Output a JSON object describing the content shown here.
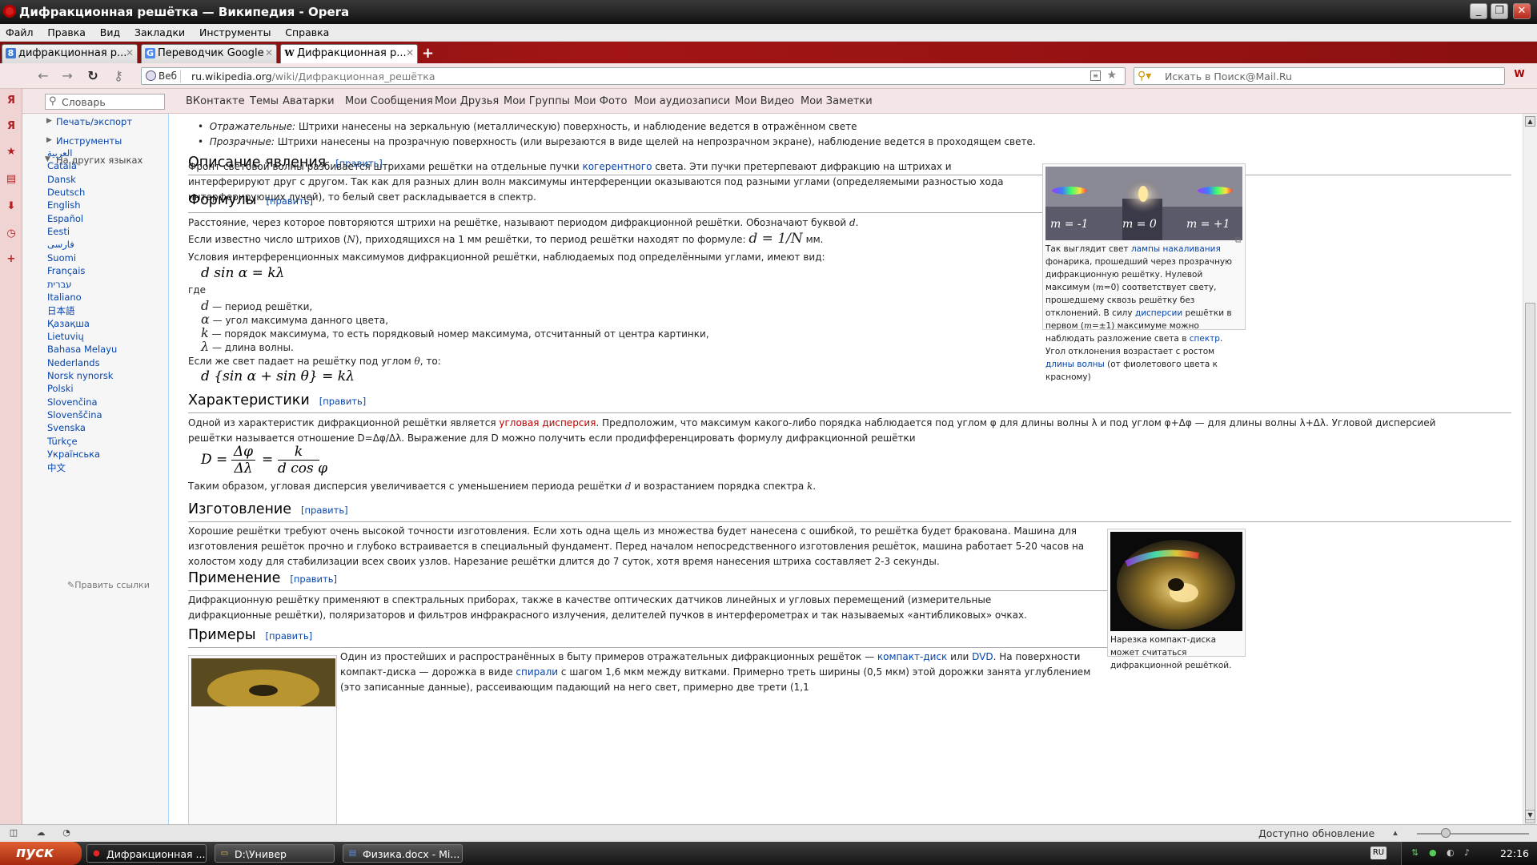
{
  "window": {
    "title": "Дифракционная решётка — Википедия - Opera"
  },
  "menu": [
    "Файл",
    "Правка",
    "Вид",
    "Закладки",
    "Инструменты",
    "Справка"
  ],
  "tabs": [
    {
      "label": "дифракционная р...",
      "icon": "yandex-icon"
    },
    {
      "label": "Переводчик Google",
      "icon": "google-translate-icon"
    },
    {
      "label": "Дифракционная р...",
      "icon": "wikipedia-icon",
      "active": true
    }
  ],
  "address": {
    "badge": "Веб",
    "host": "ru.wikipedia.org",
    "path": "/wiki/Дифракционная_решётка"
  },
  "search": {
    "placeholder": "Искать в Поиск@Mail.Ru"
  },
  "bookmarks": {
    "dict_placeholder": "Словарь",
    "items": [
      "ВКонтакте",
      "Темы",
      "Аватарки",
      "Мои Сообщения",
      "Мои Друзья",
      "Мои Группы",
      "Мои Фото",
      "Мои аудиозаписи",
      "Мои Видео",
      "Мои Заметки"
    ]
  },
  "sidebar": {
    "print_export": "Печать/экспорт",
    "tools": "Инструменты",
    "langs_head": "На других языках",
    "langs": [
      "العربية",
      "Català",
      "Dansk",
      "Deutsch",
      "English",
      "Español",
      "Eesti",
      "فارسی",
      "Suomi",
      "Français",
      "עברית",
      "Italiano",
      "日本語",
      "Қазақша",
      "Lietuvių",
      "Bahasa Melayu",
      "Nederlands",
      "Norsk nynorsk",
      "Polski",
      "Slovenčina",
      "Slovenščina",
      "Svenska",
      "Türkçe",
      "Українська",
      "中文"
    ],
    "edit_links": "Править ссылки"
  },
  "article": {
    "bullet1_em": "Отражательные:",
    "bullet1": " Штрихи нанесены на зеркальную (металлическую) поверхность, и наблюдение ведется в отражённом свете",
    "bullet2_em": "Прозрачные:",
    "bullet2": " Штрихи нанесены на прозрачную поверхность (или вырезаются в виде щелей на непрозрачном экране), наблюдение ведется в проходящем свете.",
    "edit": "[править]",
    "sec1": "Описание явления",
    "p1a": "Фронт световой волны разбивается штрихами решётки на отдельные пучки ",
    "p1link": "когерентного",
    "p1b": " света. Эти пучки претерпевают дифракцию на штрихах и интерферируют друг с другом. Так как для разных длин волн максимумы интерференции оказываются под разными углами (определяемыми разностью хода интерферирующих лучей), то белый свет раскладывается в спектр.",
    "sec2": "Формулы",
    "p2": "Расстояние, через которое повторяются штрихи на решётке, называют периодом дифракционной решётки. Обозначают буквой ",
    "p2var": "d.",
    "p3a": "Если известно число штрихов (",
    "p3N": "N",
    "p3b": "), приходящихся на 1 мм решётки, то период решётки находят по формуле: ",
    "p3f": "d = 1/N",
    "p3c": " мм.",
    "p4": "Условия интерференционных максимумов дифракционной решётки, наблюдаемых под определёнными углами, имеют вид:",
    "f1": "d sin α = kλ",
    "where": "где",
    "defs": [
      {
        "sym": "d",
        "text": " — период решётки,"
      },
      {
        "sym": "α",
        "text": " — угол максимума данного цвета,"
      },
      {
        "sym": "k",
        "text": " — порядок максимума, то есть порядковый номер максимума, отсчитанный от центра картинки,"
      },
      {
        "sym": "λ",
        "text": " — длина волны."
      }
    ],
    "p5a": "Если же свет падает на решётку под углом ",
    "p5t": "θ",
    "p5b": ", то:",
    "f2": "d {sin α + sin θ} = kλ",
    "sec3": "Характеристики",
    "p6a": "Одной из характеристик дифракционной решётки является ",
    "p6link": "угловая дисперсия",
    "p6b": ". Предположим, что максимум какого-либо порядка наблюдается под углом φ для длины волны λ и под углом φ+Δφ — для длины волны λ+Δλ. Угловой дисперсией решётки называется отношение D=Δφ/Δλ. Выражение для D можно получить если продифференцировать формулу дифракционной решётки",
    "f3_lhs": "D =",
    "f3_n1": "Δφ",
    "f3_d1": "Δλ",
    "f3_eq": "=",
    "f3_n2": "k",
    "f3_d2": "d cos φ",
    "p7a": "Таким образом, угловая дисперсия увеличивается с уменьшением периода решётки ",
    "p7d": "d",
    "p7b": " и возрастанием порядка спектра ",
    "p7k": "k",
    "p7c": ".",
    "sec4": "Изготовление",
    "p8": "Хорошие решётки требуют очень высокой точности изготовления. Если хоть одна щель из множества будет нанесена с ошибкой, то решётка будет бракована. Машина для изготовления решёток прочно и глубоко встраивается в специальный фундамент. Перед началом непосредственного изготовления решёток, машина работает 5-20 часов на холостом ходу для стабилизации всех своих узлов. Нарезание решётки длится до 7 суток, хотя время нанесения штриха составляет 2-3 секунды.",
    "sec5": "Применение",
    "p9": "Дифракционную решётку применяют в спектральных приборах, также в качестве оптических датчиков линейных и угловых перемещений (измерительные дифракционные решётки), поляризаторов и фильтров инфракрасного излучения, делителей пучков в интерферометрах и так называемых «антибликовых» очках.",
    "sec6": "Примеры",
    "p10a": "Один из простейших и распространённых в быту примеров отражательных дифракционных решёток — ",
    "p10l1": "компакт-диск",
    "p10b": " или ",
    "p10l2": "DVD",
    "p10c": ". На поверхности компакт-диска — дорожка в виде ",
    "p10l3": "спирали",
    "p10d": " с шагом 1,6 мкм между витками. Примерно треть ширины (0,5 мкм) этой дорожки занята углублением (это записанные данные), рассеивающим падающий на него свет, примерно две трети (1,1"
  },
  "thumb1": {
    "labels": [
      "m = -1",
      "m = 0",
      "m = +1"
    ],
    "cap_a": "Так выглядит свет ",
    "cap_l1": "лампы накаливания",
    "cap_b": " фонарика, прошедший через прозрачную дифракционную решётку. Нулевой максимум (",
    "cap_m0": "m",
    "cap_c": "=0) соответствует свету, прошедшему сквозь решётку без отклонений. В силу ",
    "cap_l2": "дисперсии",
    "cap_d": " решётки в первом (",
    "cap_m1": "m",
    "cap_e": "=±1) максимуме можно наблюдать разложение света в ",
    "cap_l3": "спектр",
    "cap_f": ". Угол отклонения возрастает с ростом ",
    "cap_l4": "длины волны",
    "cap_g": " (от фиолетового цвета к красному)"
  },
  "thumb2": {
    "cap": "Нарезка компакт-диска может считаться дифракционной решёткой."
  },
  "status": {
    "text": "Доступно обновление"
  },
  "taskbar": {
    "start": "пуск",
    "tasks": [
      "Дифракционная ...",
      "D:\\Универ",
      "Физика.docx - Mi..."
    ],
    "lang": "RU",
    "clock": "22:16"
  }
}
